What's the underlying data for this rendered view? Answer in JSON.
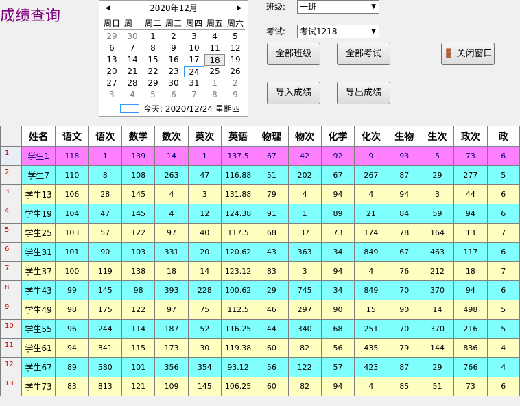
{
  "title": "成绩查询",
  "calendar": {
    "month_label": "2020年12月",
    "prev": "◀",
    "next": "▶",
    "weekdays": [
      "周日",
      "周一",
      "周二",
      "周三",
      "周四",
      "周五",
      "周六"
    ],
    "weeks": [
      [
        "29",
        "30",
        "1",
        "2",
        "3",
        "4",
        "5"
      ],
      [
        "6",
        "7",
        "8",
        "9",
        "10",
        "11",
        "12"
      ],
      [
        "13",
        "14",
        "15",
        "16",
        "17",
        "18",
        "19"
      ],
      [
        "20",
        "21",
        "22",
        "23",
        "24",
        "25",
        "26"
      ],
      [
        "27",
        "28",
        "29",
        "30",
        "31",
        "1",
        "2"
      ],
      [
        "3",
        "4",
        "5",
        "6",
        "7",
        "8",
        "9"
      ]
    ],
    "today_label": "今天: 2020/12/24 星期四"
  },
  "filters": {
    "class_label": "班级:",
    "class_value": "一班",
    "exam_label": "考试:",
    "exam_value": "考试1218"
  },
  "buttons": {
    "all_classes": "全部班级",
    "all_exams": "全部考试",
    "close_window": "关闭窗口",
    "import_scores": "导入成绩",
    "export_scores": "导出成绩"
  },
  "table": {
    "columns": [
      "姓名",
      "语文",
      "语次",
      "数学",
      "数次",
      "英次",
      "英语",
      "物理",
      "物次",
      "化学",
      "化次",
      "生物",
      "生次",
      "政次",
      "政"
    ],
    "rows": [
      {
        "num": "1",
        "cells": [
          "学生1",
          "118",
          "1",
          "139",
          "14",
          "1",
          "137.5",
          "67",
          "42",
          "92",
          "9",
          "93",
          "5",
          "73",
          "6"
        ]
      },
      {
        "num": "2",
        "cells": [
          "学生7",
          "110",
          "8",
          "108",
          "263",
          "47",
          "116.88",
          "51",
          "202",
          "67",
          "267",
          "87",
          "29",
          "277",
          "5"
        ]
      },
      {
        "num": "3",
        "cells": [
          "学生13",
          "106",
          "28",
          "145",
          "4",
          "3",
          "131.88",
          "79",
          "4",
          "94",
          "4",
          "94",
          "3",
          "44",
          "6"
        ]
      },
      {
        "num": "4",
        "cells": [
          "学生19",
          "104",
          "47",
          "145",
          "4",
          "12",
          "124.38",
          "91",
          "1",
          "89",
          "21",
          "84",
          "59",
          "94",
          "6"
        ]
      },
      {
        "num": "5",
        "cells": [
          "学生25",
          "103",
          "57",
          "122",
          "97",
          "40",
          "117.5",
          "68",
          "37",
          "73",
          "174",
          "78",
          "164",
          "13",
          "7"
        ]
      },
      {
        "num": "6",
        "cells": [
          "学生31",
          "101",
          "90",
          "103",
          "331",
          "20",
          "120.62",
          "43",
          "363",
          "34",
          "849",
          "67",
          "463",
          "117",
          "6"
        ]
      },
      {
        "num": "7",
        "cells": [
          "学生37",
          "100",
          "119",
          "138",
          "18",
          "14",
          "123.12",
          "83",
          "3",
          "94",
          "4",
          "76",
          "212",
          "18",
          "7"
        ]
      },
      {
        "num": "8",
        "cells": [
          "学生43",
          "99",
          "145",
          "98",
          "393",
          "228",
          "100.62",
          "29",
          "745",
          "34",
          "849",
          "70",
          "370",
          "94",
          "6"
        ]
      },
      {
        "num": "9",
        "cells": [
          "学生49",
          "98",
          "175",
          "122",
          "97",
          "75",
          "112.5",
          "46",
          "297",
          "90",
          "15",
          "90",
          "14",
          "498",
          "5"
        ]
      },
      {
        "num": "10",
        "cells": [
          "学生55",
          "96",
          "244",
          "114",
          "187",
          "52",
          "116.25",
          "44",
          "340",
          "68",
          "251",
          "70",
          "370",
          "216",
          "5"
        ]
      },
      {
        "num": "11",
        "cells": [
          "学生61",
          "94",
          "341",
          "115",
          "173",
          "30",
          "119.38",
          "60",
          "82",
          "56",
          "435",
          "79",
          "144",
          "836",
          "4"
        ]
      },
      {
        "num": "12",
        "cells": [
          "学生67",
          "89",
          "580",
          "101",
          "356",
          "354",
          "93.12",
          "56",
          "122",
          "57",
          "423",
          "87",
          "29",
          "766",
          "4"
        ]
      },
      {
        "num": "13",
        "cells": [
          "学生73",
          "83",
          "813",
          "121",
          "109",
          "145",
          "106.25",
          "60",
          "82",
          "94",
          "4",
          "85",
          "51",
          "73",
          "6"
        ]
      }
    ]
  }
}
